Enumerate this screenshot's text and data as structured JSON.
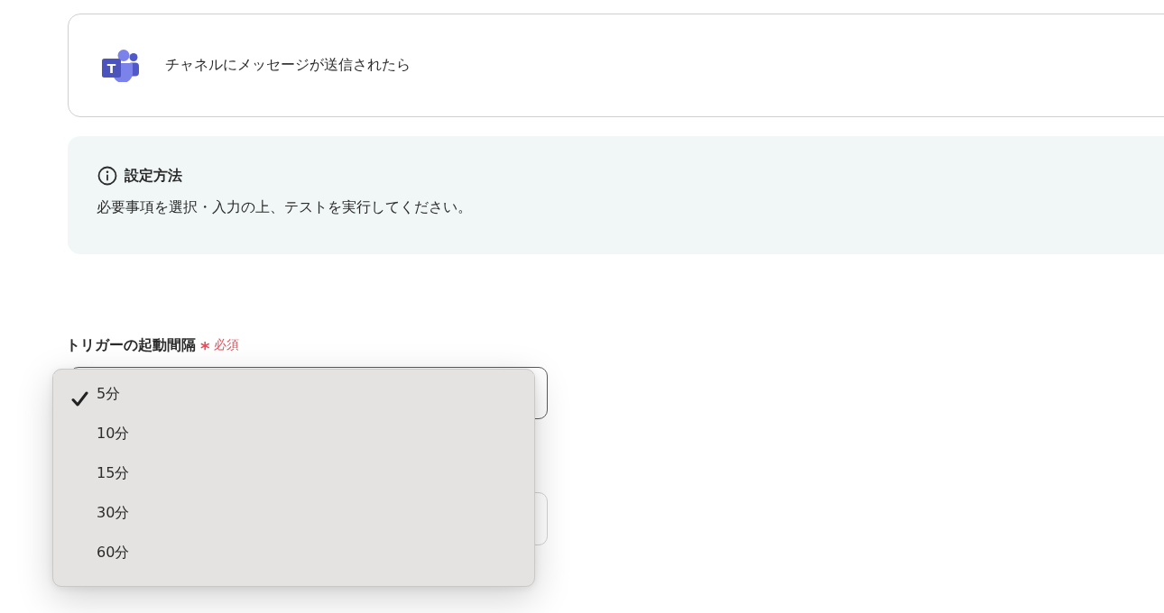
{
  "trigger_card": {
    "logo_letter": "T",
    "title": "チャネルにメッセージが送信されたら"
  },
  "info_box": {
    "title": "設定方法",
    "description": "必要事項を選択・入力の上、テストを実行してください。"
  },
  "fields": [
    {
      "kind": "select",
      "label": "トリガーの起動間隔",
      "required_mark": "*",
      "required_label": "必須",
      "open": true,
      "options": [
        {
          "label": "5分",
          "selected": true
        },
        {
          "label": "10分",
          "selected": false
        },
        {
          "label": "15分",
          "selected": false
        },
        {
          "label": "30分",
          "selected": false
        },
        {
          "label": "60分",
          "selected": false
        }
      ]
    },
    {
      "kind": "input"
    }
  ]
}
